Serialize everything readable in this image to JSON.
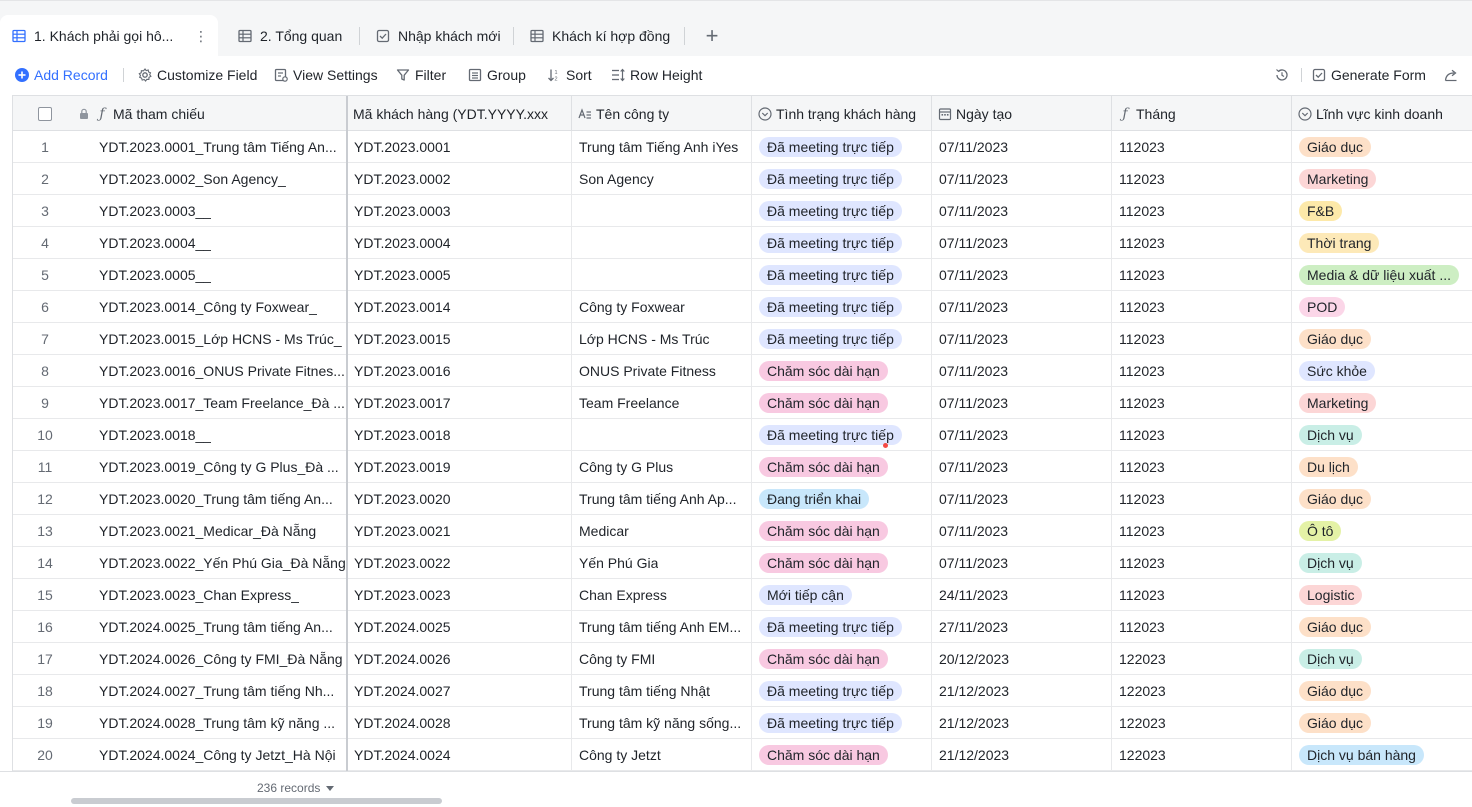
{
  "tabs": [
    {
      "label": "1. Khách phải gọi hô...",
      "icon": "grid-icon",
      "active": true
    },
    {
      "label": "2. Tổng quan",
      "icon": "grid-icon",
      "active": false
    },
    {
      "label": "Nhập khách mới",
      "icon": "form-icon",
      "active": false
    },
    {
      "label": "Khách kí hợp đồng",
      "icon": "grid-icon",
      "active": false
    }
  ],
  "toolbar": {
    "add_record": "Add Record",
    "customize_field": "Customize Field",
    "view_settings": "View Settings",
    "filter": "Filter",
    "group": "Group",
    "sort": "Sort",
    "row_height": "Row Height",
    "generate_form": "Generate Form"
  },
  "columns": [
    {
      "label": "Mã tham chiếu",
      "icon": "formula-icon"
    },
    {
      "label": "Mã khách hàng (YDT.YYYY.xxx",
      "icon": ""
    },
    {
      "label": "Tên công ty",
      "icon": "text-icon"
    },
    {
      "label": "Tình trạng khách hàng",
      "icon": "single-select-icon"
    },
    {
      "label": "Ngày tạo",
      "icon": "date-icon"
    },
    {
      "label": "Tháng",
      "icon": "formula-icon"
    },
    {
      "label": "Lĩnh vực kinh doanh",
      "icon": "single-select-icon"
    }
  ],
  "rows": [
    {
      "n": "1",
      "ref": "YDT.2023.0001_Trung tâm Tiếng An...",
      "code": "YDT.2023.0001",
      "company": "Trung tâm Tiếng Anh iYes",
      "status": "Đã meeting trực tiếp",
      "date": "07/11/2023",
      "month": "112023",
      "field": "Giáo dục"
    },
    {
      "n": "2",
      "ref": "YDT.2023.0002_Son Agency_",
      "code": "YDT.2023.0002",
      "company": "Son Agency",
      "status": "Đã meeting trực tiếp",
      "date": "07/11/2023",
      "month": "112023",
      "field": "Marketing"
    },
    {
      "n": "3",
      "ref": "YDT.2023.0003__",
      "code": "YDT.2023.0003",
      "company": "",
      "status": "Đã meeting trực tiếp",
      "date": "07/11/2023",
      "month": "112023",
      "field": "F&B"
    },
    {
      "n": "4",
      "ref": "YDT.2023.0004__",
      "code": "YDT.2023.0004",
      "company": "",
      "status": "Đã meeting trực tiếp",
      "date": "07/11/2023",
      "month": "112023",
      "field": "Thời trang"
    },
    {
      "n": "5",
      "ref": "YDT.2023.0005__",
      "code": "YDT.2023.0005",
      "company": "",
      "status": "Đã meeting trực tiếp",
      "date": "07/11/2023",
      "month": "112023",
      "field": "Media & dữ liệu xuất ..."
    },
    {
      "n": "6",
      "ref": "YDT.2023.0014_Công ty Foxwear_",
      "code": "YDT.2023.0014",
      "company": "Công ty Foxwear",
      "status": "Đã meeting trực tiếp",
      "date": "07/11/2023",
      "month": "112023",
      "field": "POD"
    },
    {
      "n": "7",
      "ref": "YDT.2023.0015_Lớp HCNS - Ms Trúc_",
      "code": "YDT.2023.0015",
      "company": "Lớp HCNS - Ms Trúc",
      "status": "Đã meeting trực tiếp",
      "date": "07/11/2023",
      "month": "112023",
      "field": "Giáo dục"
    },
    {
      "n": "8",
      "ref": "YDT.2023.0016_ONUS Private Fitnes...",
      "code": "YDT.2023.0016",
      "company": "ONUS Private Fitness",
      "status": "Chăm sóc dài hạn",
      "date": "07/11/2023",
      "month": "112023",
      "field": "Sức khỏe"
    },
    {
      "n": "9",
      "ref": "YDT.2023.0017_Team Freelance_Đà ...",
      "code": "YDT.2023.0017",
      "company": "Team Freelance",
      "status": "Chăm sóc dài hạn",
      "date": "07/11/2023",
      "month": "112023",
      "field": "Marketing"
    },
    {
      "n": "10",
      "ref": "YDT.2023.0018__",
      "code": "YDT.2023.0018",
      "company": "",
      "status": "Đã meeting trực tiếp",
      "date": "07/11/2023",
      "month": "112023",
      "field": "Dịch vụ"
    },
    {
      "n": "11",
      "ref": "YDT.2023.0019_Công ty G Plus_Đà ...",
      "code": "YDT.2023.0019",
      "company": "Công ty G Plus",
      "status": "Chăm sóc dài hạn",
      "date": "07/11/2023",
      "month": "112023",
      "field": "Du lịch"
    },
    {
      "n": "12",
      "ref": "YDT.2023.0020_Trung tâm tiếng An...",
      "code": "YDT.2023.0020",
      "company": "Trung tâm tiếng Anh Ap...",
      "status": "Đang triển khai",
      "date": "07/11/2023",
      "month": "112023",
      "field": "Giáo dục"
    },
    {
      "n": "13",
      "ref": "YDT.2023.0021_Medicar_Đà Nẵng",
      "code": "YDT.2023.0021",
      "company": "Medicar",
      "status": "Chăm sóc dài hạn",
      "date": "07/11/2023",
      "month": "112023",
      "field": "Ô tô"
    },
    {
      "n": "14",
      "ref": "YDT.2023.0022_Yến Phú Gia_Đà Nẵng",
      "code": "YDT.2023.0022",
      "company": "Yến Phú Gia",
      "status": "Chăm sóc dài hạn",
      "date": "07/11/2023",
      "month": "112023",
      "field": "Dịch vụ"
    },
    {
      "n": "15",
      "ref": "YDT.2023.0023_Chan Express_",
      "code": "YDT.2023.0023",
      "company": "Chan Express",
      "status": "Mới tiếp cận",
      "date": "24/11/2023",
      "month": "112023",
      "field": "Logistic"
    },
    {
      "n": "16",
      "ref": "YDT.2024.0025_Trung tâm tiếng An...",
      "code": "YDT.2024.0025",
      "company": "Trung tâm tiếng Anh EM...",
      "status": "Đã meeting trực tiếp",
      "date": "27/11/2023",
      "month": "112023",
      "field": "Giáo dục"
    },
    {
      "n": "17",
      "ref": "YDT.2024.0026_Công ty FMI_Đà Nẵng",
      "code": "YDT.2024.0026",
      "company": "Công ty FMI",
      "status": "Chăm sóc dài hạn",
      "date": "20/12/2023",
      "month": "122023",
      "field": "Dịch vụ"
    },
    {
      "n": "18",
      "ref": "YDT.2024.0027_Trung tâm tiếng Nh...",
      "code": "YDT.2024.0027",
      "company": "Trung tâm tiếng Nhật",
      "status": "Đã meeting trực tiếp",
      "date": "21/12/2023",
      "month": "122023",
      "field": "Giáo dục"
    },
    {
      "n": "19",
      "ref": "YDT.2024.0028_Trung tâm kỹ năng ...",
      "code": "YDT.2024.0028",
      "company": "Trung tâm kỹ năng sống...",
      "status": "Đã meeting trực tiếp",
      "date": "21/12/2023",
      "month": "122023",
      "field": "Giáo dục"
    },
    {
      "n": "20",
      "ref": "YDT.2024.0024_Công ty Jetzt_Hà Nội",
      "code": "YDT.2024.0024",
      "company": "Công ty Jetzt",
      "status": "Chăm sóc dài hạn",
      "date": "21/12/2023",
      "month": "122023",
      "field": "Dịch vụ bán hàng"
    }
  ],
  "status_colors": {
    "Đã meeting trực tiếp": {
      "bg": "#dfe6ff",
      "fg": "#1f2329"
    },
    "Chăm sóc dài hạn": {
      "bg": "#f8c9e1",
      "fg": "#1f2329"
    },
    "Đang triển khai": {
      "bg": "#c8e7fb",
      "fg": "#1f2329"
    },
    "Mới tiếp cận": {
      "bg": "#dfe6ff",
      "fg": "#1f2329"
    }
  },
  "field_colors": {
    "Giáo dục": {
      "bg": "#fde0c8",
      "fg": "#1f2329"
    },
    "Marketing": {
      "bg": "#fcd6d6",
      "fg": "#1f2329"
    },
    "F&B": {
      "bg": "#fde9a9",
      "fg": "#1f2329"
    },
    "Thời trang": {
      "bg": "#fde9b8",
      "fg": "#1f2329"
    },
    "Media & dữ liệu xuất ...": {
      "bg": "#cdeec3",
      "fg": "#1f2329"
    },
    "POD": {
      "bg": "#fbd6e8",
      "fg": "#1f2329"
    },
    "Sức khỏe": {
      "bg": "#dfe6ff",
      "fg": "#1f2329"
    },
    "Dịch vụ": {
      "bg": "#c9eee6",
      "fg": "#1f2329"
    },
    "Du lịch": {
      "bg": "#fde0c8",
      "fg": "#1f2329"
    },
    "Ô tô": {
      "bg": "#e4f2a6",
      "fg": "#1f2329"
    },
    "Logistic": {
      "bg": "#fcd6d6",
      "fg": "#1f2329"
    },
    "Dịch vụ bán hàng": {
      "bg": "#c8e7fb",
      "fg": "#1f2329"
    }
  },
  "footer": {
    "record_count": "236 records"
  },
  "colors": {
    "accent": "#3370ff",
    "tab_bg": "#f5f6f7"
  }
}
